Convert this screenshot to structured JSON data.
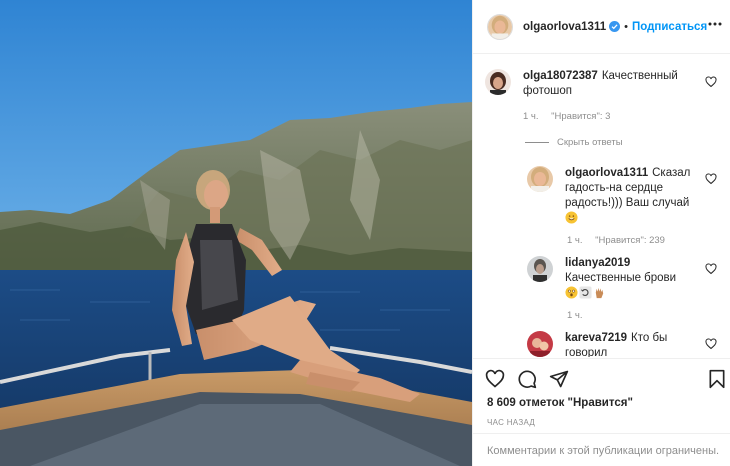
{
  "post": {
    "author": "olgaorlova1311",
    "separator": "•",
    "follow_label": "Подписаться"
  },
  "comments": [
    {
      "user": "olga18072387",
      "text_line1": "Качественный",
      "text_line2": "фотошоп",
      "time": "1 ч.",
      "likes": "\"Нравится\": 3"
    }
  ],
  "hide_replies_label": "Скрыть ответы",
  "replies": [
    {
      "user": "olgaorlova1311",
      "text_line1": "Сказал",
      "text_line2": "гадость-на сердце",
      "text_line3": "радость!))) Ваш случай",
      "emoji": "grinning-face-sweat",
      "time": "1 ч.",
      "likes": "\"Нравится\": 239"
    },
    {
      "user": "lidanya2019",
      "text_line1": "Качественные брови",
      "emojis": [
        "astonished-face",
        "counterclockwise-arrows",
        "waving-hand"
      ],
      "time": "1 ч."
    },
    {
      "user": "kareva7219",
      "text_line1": "Кто бы",
      "text_line2": "говорил"
    }
  ],
  "actions": {
    "likes_text": "8 609 отметок \"Нравится\"",
    "time_text": "ЧАС НАЗАД",
    "comments_closed": "Комментарии к этой публикации ограничены."
  },
  "icons": {
    "verified": "verified-badge-icon",
    "more": "more-options-icon",
    "heart": "heart-icon",
    "comment": "comment-icon",
    "share": "share-icon",
    "save": "bookmark-icon"
  },
  "colors": {
    "link_blue": "#0095f6",
    "text": "#262626",
    "muted": "#8e8e8e",
    "border": "#efefef"
  }
}
